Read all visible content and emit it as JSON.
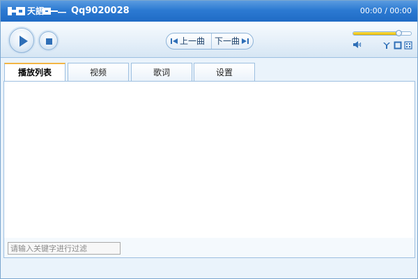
{
  "titlebar": {
    "logo_text": "天語",
    "song_title": "Qq9020028",
    "time": "00:00 / 00:00"
  },
  "controls": {
    "play_icon": "play-icon",
    "stop_icon": "stop-icon",
    "prev_label": "上一曲",
    "next_label": "下一曲",
    "volume_level": 0.8,
    "speaker_icon": "speaker-icon",
    "extra_icons": [
      "skin-icon",
      "window-icon",
      "fullscreen-icon"
    ]
  },
  "tabs": [
    {
      "label": "播放列表",
      "active": true
    },
    {
      "label": "视频",
      "active": false
    },
    {
      "label": "歌词",
      "active": false
    },
    {
      "label": "设置",
      "active": false
    }
  ],
  "filter": {
    "placeholder": "请输入关键字进行过滤"
  },
  "colors": {
    "titlebar": "#2c7ad2",
    "accent_tab": "#f2b544",
    "volume_fill": "#f0c800"
  }
}
